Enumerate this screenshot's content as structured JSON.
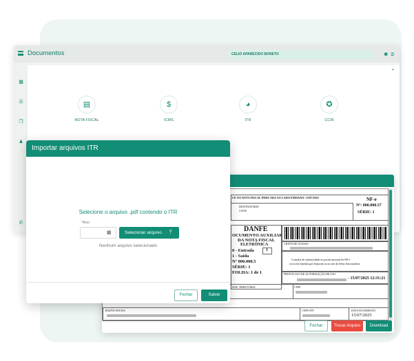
{
  "app": {
    "title": "Documentos",
    "user_name": "CELIO APARECIDO BONETO",
    "icons": {
      "menu": "hamburger-icon",
      "user": "user-icon",
      "logout": "logout-icon",
      "expand": "chevron-down-icon"
    },
    "sidebar_icons": [
      "calendar-icon",
      "layers-icon",
      "copy-icon",
      "users-icon",
      "whatsapp-icon"
    ]
  },
  "modules": [
    {
      "label": "NOTA FISCAL",
      "icon": "invoice-icon"
    },
    {
      "label": "ICMS",
      "icon": "money-bag-icon"
    },
    {
      "label": "ITR",
      "icon": "globe-icon"
    },
    {
      "label": "CCIR",
      "icon": "certificate-icon"
    }
  ],
  "preview": {
    "doc": {
      "receipt_line": "CE NA NOTA FISCAL INDICADA AO LADO EMISSÃO: 15/07/2025",
      "recipient_label": "DESTINATÁRIO",
      "recipient_value": "COOP.",
      "nfe_label": "NF-e",
      "nfe_number": "Nº: 000.000.57",
      "nfe_serie": "SÉRIE: 1",
      "danfe_title": "DANFE",
      "danfe_sub1": "OCUMENTO AUXILIAR",
      "danfe_sub2": "DA NOTA FISCAL",
      "danfe_sub3": "ELETRÔNICA",
      "entry_label": "0 - Entrada",
      "exit_label": "1 - Saída",
      "type_value": "1",
      "number_line": "Nº     000.000.5",
      "serie_line": "SÉRIE:      1",
      "page_line": "FOLHA:     1 de 1",
      "access_key_label": "CHAVE DE ACESSO",
      "consult_line1": "Consulta de autenticidade no portal nacional da NF-e",
      "consult_line2": "www.nfe.fazenda.gov.br/portal ou no site da Sefaz Autorizadora",
      "protocol_label": "PROTOCOLO DE AUTORIZAÇÃO DE USO",
      "protocol_value": "- 15/07/2025 12:31:21",
      "subst_label": "SUB. TRIBUTÁRIA",
      "cnpj_label": "CNPJ",
      "razao_label": "RAZÃO SOCIAL",
      "cnpj_cpf_label": "CNPJ/CPF",
      "emission_label": "DATA DA EMISSÃO",
      "emission_value": "15/07/2025"
    },
    "buttons": {
      "close": "Fechar",
      "change": "Trocar Arquivo",
      "download": "Download"
    }
  },
  "import_modal": {
    "title": "Importar arquivos ITR",
    "instruction": "Selecione o arquivo .pdf contendo o ITR",
    "year_label": "*Ano",
    "year_value": "",
    "select_button": "Selecionar arquivo",
    "no_file": "Nenhum arquivo selecionado",
    "close_button": "Fechar",
    "save_button": "Salvar",
    "icons": {
      "calendar": "calendar-icon",
      "upload": "upload-icon"
    }
  },
  "colors": {
    "primary": "#128d76",
    "danger": "#e94b3f",
    "background": "#eef6f3"
  }
}
